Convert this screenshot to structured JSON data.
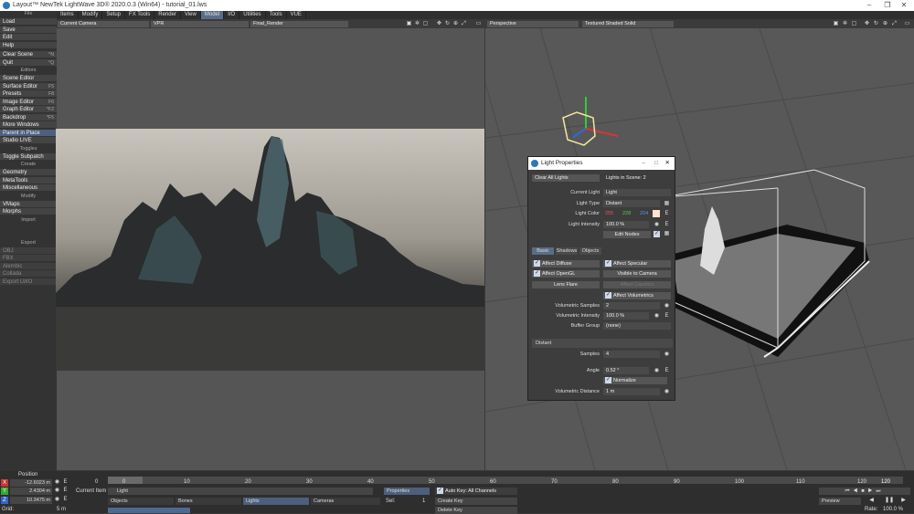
{
  "title": "Layout™ NewTek LightWave 3D® 2020.0.3 (Win64) - tutorial_01.lws",
  "menu": [
    {
      "label": "Items"
    },
    {
      "label": "Modify"
    },
    {
      "label": "Setup"
    },
    {
      "label": "FX Tools"
    },
    {
      "label": "Render"
    },
    {
      "label": "View"
    },
    {
      "label": "Model",
      "active": true
    },
    {
      "label": "I/O"
    },
    {
      "label": "Utilities"
    },
    {
      "label": "Tools"
    },
    {
      "label": "VUE"
    }
  ],
  "left_toolbar": {
    "file_header": "File",
    "file": [
      {
        "label": "Load",
        "key": ""
      },
      {
        "label": "Save",
        "key": ""
      },
      {
        "label": "Edit",
        "key": ""
      },
      {
        "label": "Help",
        "key": ""
      }
    ],
    "clear": [
      {
        "label": "Clear Scene",
        "key": "^N"
      },
      {
        "label": "Quit",
        "key": "^Q"
      }
    ],
    "editors_header": "Editors",
    "editors": [
      {
        "label": "Scene Editor",
        "key": ""
      },
      {
        "label": "Surface Editor",
        "key": "F5"
      },
      {
        "label": "Presets",
        "key": "F8"
      },
      {
        "label": "Image Editor",
        "key": "F6"
      },
      {
        "label": "Graph Editor",
        "key": "^F2"
      },
      {
        "label": "Backdrop",
        "key": "^F5"
      },
      {
        "label": "More Windows",
        "key": ""
      }
    ],
    "parent": "Parent in Place",
    "studio": "Studio LIVE",
    "toggles_header": "Toggles",
    "toggle": "Toggle Subpatch",
    "create_header": "Create",
    "create": [
      "Geometry",
      "MetaTools",
      "Miscellaneous"
    ],
    "modify_header": "Modify",
    "modify": [
      "VMaps",
      "Morphs"
    ],
    "import_header": "Import",
    "export_header": "Export",
    "export_items": [
      "OBJ",
      "FBX",
      "Alembic",
      "Collada",
      "Export LWO"
    ]
  },
  "left_viewport": {
    "camera": "Current Camera",
    "mode": "VPR",
    "render": "Final_Render"
  },
  "right_viewport": {
    "view": "Perspective",
    "shading": "Textured Shaded Solid"
  },
  "light_panel": {
    "title": "Light Properties",
    "clear_all": "Clear All Lights",
    "lights_in_scene": "Lights in Scene: 2",
    "current_item_label": "Current Light",
    "current_item": "Light",
    "type_label": "Light Type",
    "type": "Distant",
    "color_label": "Light Color",
    "color_r": "255",
    "color_g": "228",
    "color_b": "204",
    "intensity_label": "Light Intensity",
    "intensity": "100.0 %",
    "edit_nodes": "Edit Nodes",
    "tabs": [
      {
        "label": "Basic",
        "on": true
      },
      {
        "label": "Shadows"
      },
      {
        "label": "Objects"
      }
    ],
    "affect_diffuse": "Affect Diffuse",
    "affect_specular": "Affect Specular",
    "affect_opengl": "Affect OpenGL",
    "visible_camera": "Visible to Camera",
    "lens_flare": "Lens Flare",
    "affect_caustics": "Affect Caustics",
    "affect_volumetrics": "Affect Volumetrics",
    "vol_samples_label": "Volumetric Samples",
    "vol_samples": "2",
    "vol_intensity_label": "Volumetric Intensity",
    "vol_intensity": "100.0 %",
    "buffer_group_label": "Buffer Group",
    "buffer_group": "(none)",
    "section": "Distant",
    "samples_label": "Samples",
    "samples": "4",
    "angle_label": "Angle",
    "angle": "0.52 °",
    "normalize": "Normalize",
    "vol_distance_label": "Volumetric Distance",
    "vol_distance": "1 m"
  },
  "bottom": {
    "position_label": "Position",
    "x": "-12.6023 m",
    "y": "2.4304 m",
    "z": "10.3475 m",
    "grid_label": "Grid:",
    "grid": "5 m",
    "current_item_label": "Current Item",
    "current_item": "Light",
    "objects": "Objects",
    "bones": "Bones",
    "lights": "Lights",
    "cameras": "Cameras",
    "properties": "Properties",
    "sel_label": "Sel:",
    "sel": "1",
    "auto_key": "Auto Key: All Channels",
    "create_key": "Create Key",
    "delete_key": "Delete Key",
    "preview": "Preview",
    "rate_label": "Rate:",
    "rate": "100.0 %",
    "end_frame": "120"
  },
  "timeline": {
    "ticks": [
      "0",
      "10",
      "20",
      "30",
      "40",
      "50",
      "60",
      "70",
      "80",
      "90",
      "100",
      "110",
      "120"
    ],
    "start": "0"
  }
}
